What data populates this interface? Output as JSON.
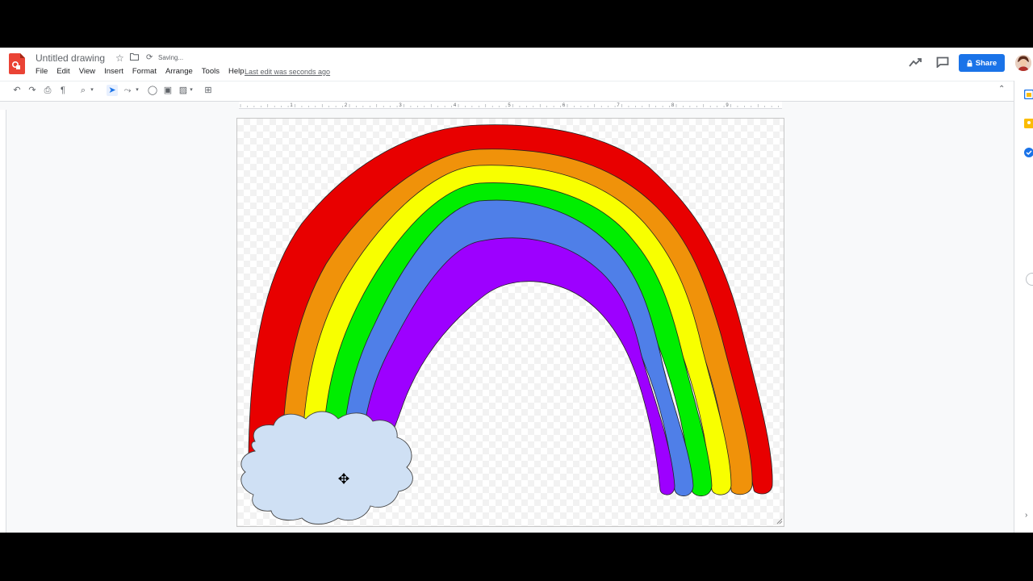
{
  "header": {
    "doc_title": "Untitled drawing",
    "saving_status": "Saving...",
    "last_edit": "Last edit was seconds ago",
    "share_label": "Share"
  },
  "menu": {
    "items": [
      "File",
      "Edit",
      "View",
      "Insert",
      "Format",
      "Arrange",
      "Tools",
      "Help"
    ]
  },
  "ruler": {
    "ticks": [
      "1",
      "2",
      "3",
      "4",
      "5",
      "6",
      "7",
      "8",
      "9"
    ]
  },
  "colors": {
    "share_blue": "#1a73e8",
    "logo_red": "#ea4335",
    "rainbow": [
      "#e80000",
      "#f0920a",
      "#f8ff00",
      "#00ee00",
      "#4f7fe8",
      "#9d00ff"
    ],
    "cloud": "#cfe0f4"
  },
  "icons": {
    "toolbar": [
      "undo-icon",
      "redo-icon",
      "print-icon",
      "paint-format-icon",
      "zoom-icon",
      "select-icon",
      "line-icon",
      "shape-icon",
      "text-box-icon",
      "image-icon",
      "comment-add-icon"
    ],
    "side_panel": [
      "calendar-icon",
      "keep-icon",
      "tasks-icon"
    ]
  }
}
